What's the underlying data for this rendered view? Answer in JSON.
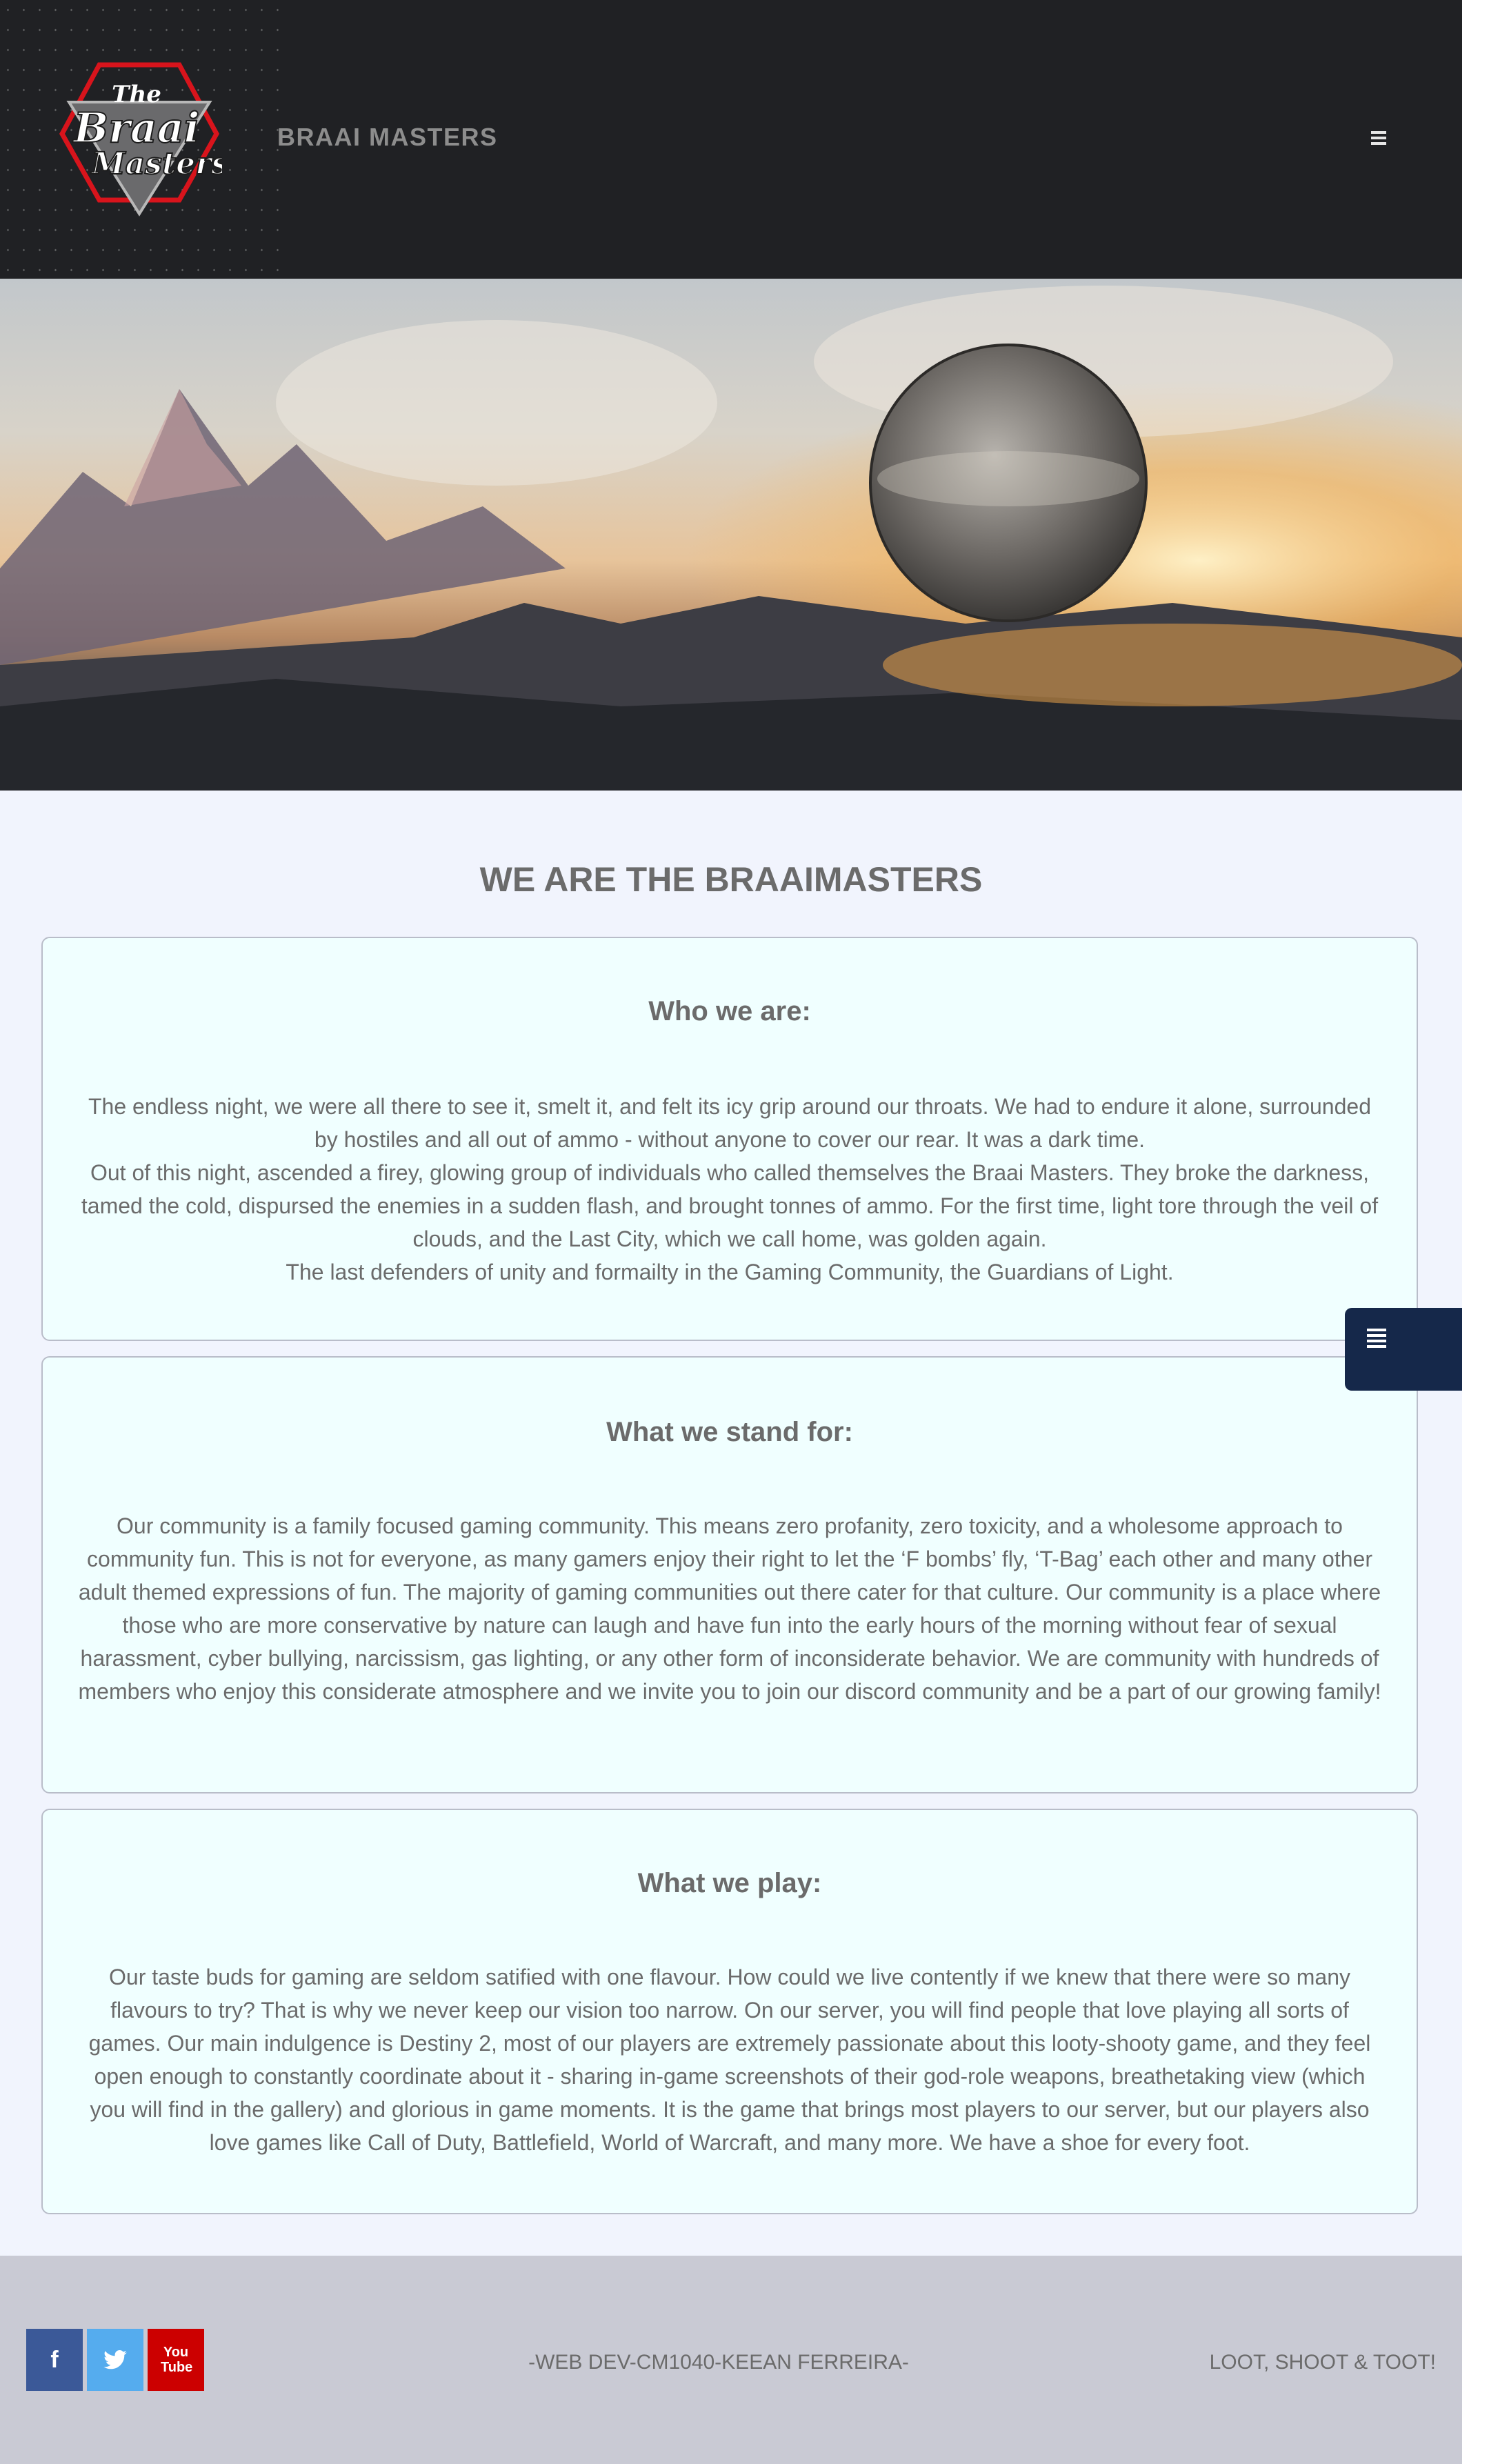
{
  "header": {
    "brand": "BRAAI MASTERS",
    "logo_text_line1": "The",
    "logo_text_line2": "Braai",
    "logo_text_line3": "Masters",
    "menu_icon": "hamburger-icon"
  },
  "hero": {
    "description": ""
  },
  "main": {
    "title": "WE ARE THE BRAAIMASTERS",
    "cards": [
      {
        "heading": "Who we are:",
        "body": "The endless night, we were all there to see it, smelt it, and felt its icy grip around our throats. We had to endure it alone, surrounded by hostiles and all out of ammo - without anyone to cover our rear. It was a dark time.\nOut of this night, ascended a firey, glowing group of individuals who called themselves the Braai Masters. They broke the darkness, tamed the cold, dispursed the enemies in a sudden flash, and brought tonnes of ammo. For the first time, light tore through the veil of clouds, and the Last City, which we call home, was golden again.\nThe last defenders of unity and formailty in the Gaming Community, the Guardians of Light."
      },
      {
        "heading": "What we stand for:",
        "body": "Our community is a family focused gaming community. This means zero profanity, zero toxicity, and a wholesome approach to community fun. This is not for everyone, as many gamers enjoy their right to let the ‘F bombs’ fly, ‘T-Bag’ each other and many other adult themed expressions of fun. The majority of gaming communities out there cater for that culture. Our community is a place where those who are more conservative by nature can laugh and have fun into the early hours of the morning without fear of sexual harassment, cyber bullying, narcissism, gas lighting, or any other form of inconsiderate behavior. We are community with hundreds of members who enjoy this considerate atmosphere and we invite you to join our discord community and be a part of our growing family!"
      },
      {
        "heading": "What we play:",
        "body": "Our taste buds for gaming are seldom satified with one flavour. How could we live contently if we knew that there were so many flavours to try? That is why we never keep our vision too narrow. On our server, you will find people that love playing all sorts of games. Our main indulgence is Destiny 2, most of our players are extremely passionate about this looty-shooty game, and they feel open enough to constantly coordinate about it - sharing in-game screenshots of their god-role weapons, breathetaking view (which you will find in the gallery) and glorious in game moments. It is the game that brings most players to our server, but our players also love games like Call of Duty, Battlefield, World of Warcraft, and many more. We have a shoe for every foot."
      }
    ]
  },
  "side_tab": {
    "icon": "list-icon"
  },
  "footer": {
    "social": [
      {
        "name": "facebook",
        "glyph": "f",
        "color": "#3b5998"
      },
      {
        "name": "twitter",
        "glyph": "t",
        "color": "#55acee"
      },
      {
        "name": "youtube",
        "glyph": "You Tube",
        "color": "#cc0000"
      }
    ],
    "credit": "-WEB DEV-CM1040-KEEAN FERREIRA-",
    "motto": "LOOT, SHOOT & TOOT!"
  }
}
